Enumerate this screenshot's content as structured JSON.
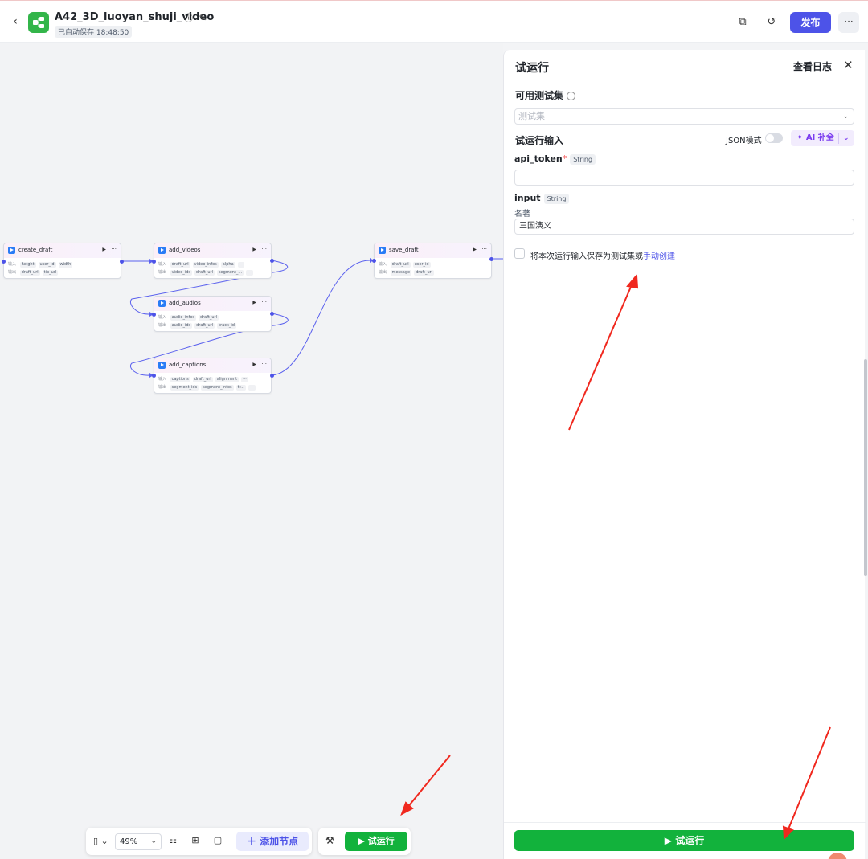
{
  "header": {
    "back_icon": "chevron-left-icon",
    "app_title": "A42_3D_luoyan_shuji_video",
    "autosave": "已自动保存 18:48:50",
    "publish_label": "发布",
    "more_label": "···"
  },
  "canvas": {
    "nodes": [
      {
        "title": "create_draft",
        "input_label": "输入",
        "inputs": [
          "height",
          "user_id",
          "width"
        ],
        "output_label": "输出",
        "outputs": [
          "draft_url",
          "tip_url"
        ]
      },
      {
        "title": "add_videos",
        "input_label": "输入",
        "inputs": [
          "draft_url",
          "video_infos",
          "alpha",
          "···"
        ],
        "output_label": "输出",
        "outputs": [
          "video_ids",
          "draft_url",
          "segment_...",
          "···"
        ]
      },
      {
        "title": "add_audios",
        "input_label": "输入",
        "inputs": [
          "audio_infos",
          "draft_url"
        ],
        "output_label": "输出",
        "outputs": [
          "audio_ids",
          "draft_url",
          "track_id"
        ]
      },
      {
        "title": "add_captions",
        "input_label": "输入",
        "inputs": [
          "captions",
          "draft_url",
          "alignment",
          "···"
        ],
        "output_label": "输出",
        "outputs": [
          "segment_ids",
          "segment_infos",
          "tr...",
          "···"
        ]
      },
      {
        "title": "save_draft",
        "input_label": "输入",
        "inputs": [
          "draft_url",
          "user_id"
        ],
        "output_label": "输出",
        "outputs": [
          "message",
          "draft_url"
        ]
      }
    ]
  },
  "toolbar": {
    "zoom": "49%",
    "add_node_label": "＋ 添加节点",
    "run_label": "▶  试运行"
  },
  "panel": {
    "title": "试运行",
    "view_log": "查看日志",
    "testset_label": "可用测试集",
    "testset_placeholder": "测试集",
    "run_input_label": "试运行输入",
    "json_mode_label": "JSON模式",
    "ai_fill_label": "✦ AI 补全",
    "fields": [
      {
        "name": "api_token",
        "required": "*",
        "type": "String",
        "value": ""
      },
      {
        "name": "input",
        "type": "String",
        "description": "名著",
        "value": "三国演义"
      }
    ],
    "save_text": "将本次运行输入保存为测试集或",
    "save_link": "手动创建",
    "run_label": "▶  试运行"
  },
  "colors": {
    "primary": "#4d53e8",
    "run_green": "#12b23c",
    "annotation_red": "#f0281e"
  }
}
